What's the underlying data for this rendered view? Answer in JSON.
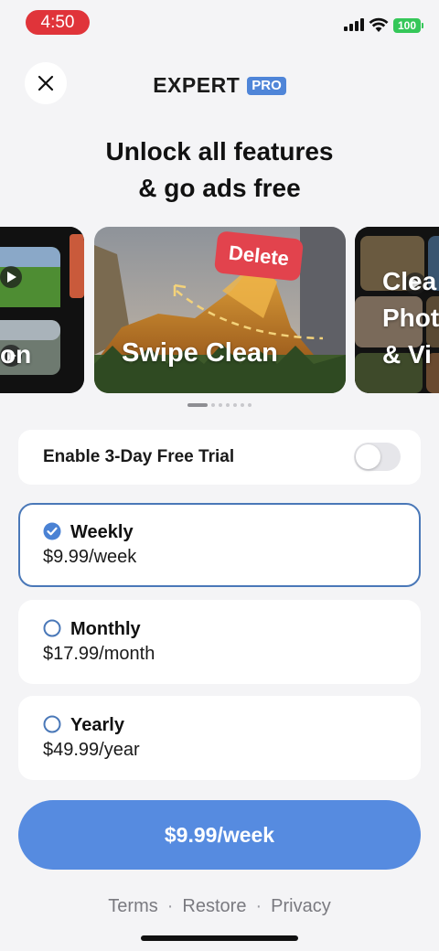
{
  "status_bar": {
    "time": "4:50",
    "battery": "100",
    "icons": [
      "signal-icon",
      "wifi-icon",
      "battery-icon"
    ]
  },
  "header": {
    "close_icon": "close-icon",
    "brand_name": "EXPERT",
    "brand_badge": "PRO"
  },
  "headline": {
    "line1": "Unlock all features",
    "line2": "& go ads free"
  },
  "carousel": {
    "left_card_label": "on",
    "center_card_label": "Swipe Clean",
    "center_card_tag": "Delete",
    "right_card_label_lines": [
      "Clea",
      "Phot",
      "& Vi"
    ],
    "page_count": 7,
    "active_index": 0
  },
  "trial": {
    "label": "Enable 3-Day Free Trial",
    "enabled": false
  },
  "plans": [
    {
      "name": "Weekly",
      "price": "$9.99/week",
      "selected": true
    },
    {
      "name": "Monthly",
      "price": "$17.99/month",
      "selected": false
    },
    {
      "name": "Yearly",
      "price": "$49.99/year",
      "selected": false
    }
  ],
  "cta": {
    "label": "$9.99/week"
  },
  "footer": {
    "links": [
      "Terms",
      "Restore",
      "Privacy"
    ],
    "separator": "·"
  },
  "colors": {
    "accent": "#568be0",
    "selected_border": "#4a78b8",
    "delete_tag": "#e2434d",
    "time_pill": "#e0343a",
    "battery": "#35c759"
  }
}
